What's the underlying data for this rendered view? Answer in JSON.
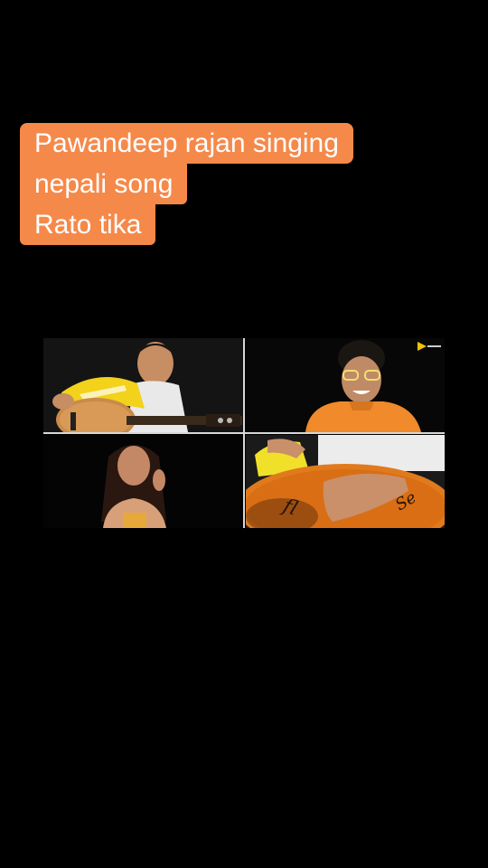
{
  "caption": {
    "lines": [
      "Pawandeep rajan singing",
      "nepali song",
      "Rato tika"
    ]
  },
  "colors": {
    "caption_background": "#f5894a",
    "caption_text": "#ffffff",
    "page_background": "#000000"
  },
  "video": {
    "tiles": [
      {
        "name": "guitarist-tile"
      },
      {
        "name": "singer-tile"
      },
      {
        "name": "female-singer-tile"
      },
      {
        "name": "drummer-tile"
      }
    ]
  }
}
